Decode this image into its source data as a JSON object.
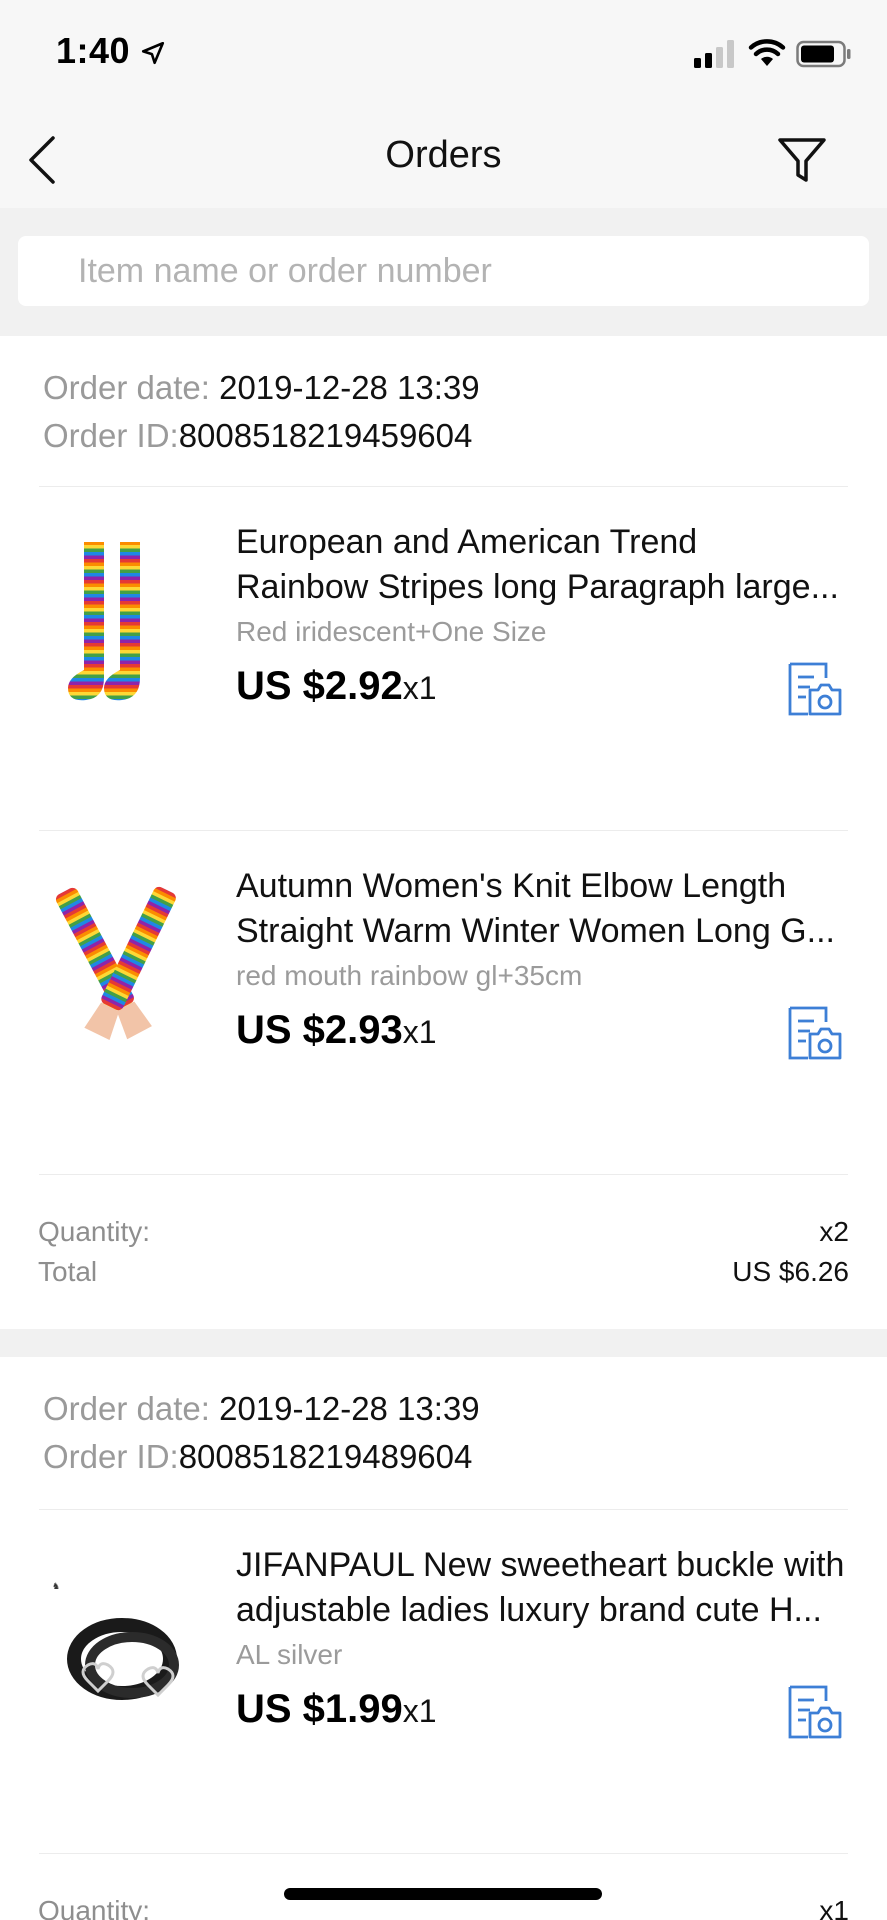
{
  "status_bar": {
    "time": "1:40"
  },
  "nav": {
    "title": "Orders",
    "back_icon": "chevron-left-icon",
    "filter_icon": "filter-funnel-icon"
  },
  "search": {
    "placeholder": "Item name or order number",
    "value": ""
  },
  "labels": {
    "order_date": "Order date: ",
    "order_id": "Order ID:",
    "quantity": "Quantity:",
    "total": "Total"
  },
  "orders": [
    {
      "date": "2019-12-28 13:39",
      "id": "8008518219459604",
      "items": [
        {
          "title_line1": "European and American Trend",
          "title_line2": "Rainbow Stripes long Paragraph large...",
          "sku": "Red iridescent+One Size",
          "price": "US $2.92",
          "qty": "x1",
          "image": "rainbow-striped-socks"
        },
        {
          "title_line1": "Autumn Women's Knit Elbow Length",
          "title_line2": "Straight Warm Winter Women Long G...",
          "sku": "red mouth rainbow gl+35cm",
          "price": "US $2.93",
          "qty": "x1",
          "image": "rainbow-arm-warmers"
        }
      ],
      "quantity": "x2",
      "total": "US $6.26"
    },
    {
      "date": "2019-12-28 13:39",
      "id": "8008518219489604",
      "items": [
        {
          "title_line1": "JIFANPAUL New sweetheart buckle with",
          "title_line2": "adjustable ladies luxury brand cute H...",
          "sku": "AL silver",
          "price": "US $1.99",
          "qty": "x1",
          "image": "black-heart-buckle-belt"
        }
      ],
      "quantity": "x1"
    }
  ],
  "colors": {
    "accent_blue": "#3d7fd6",
    "background_gray": "#f1f1f1"
  }
}
